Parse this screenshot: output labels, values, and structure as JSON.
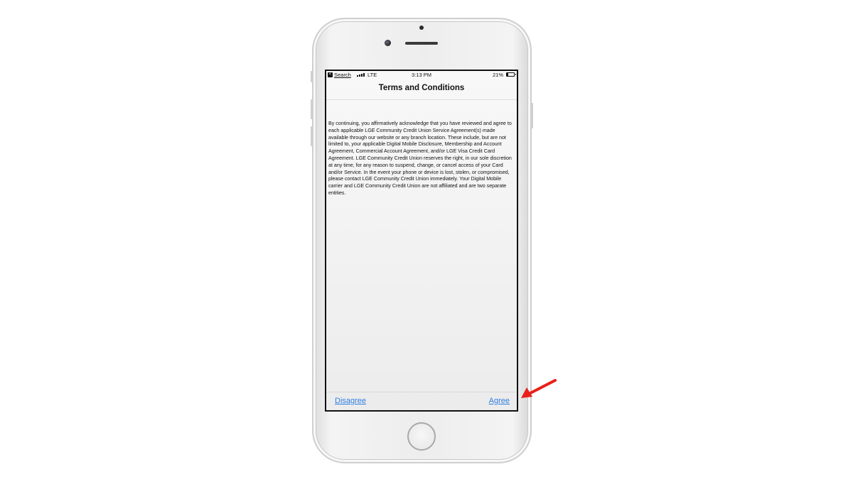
{
  "status_bar": {
    "back_badge": "<",
    "back_label": "Search",
    "carrier": "LTE",
    "time": "3:13 PM",
    "battery_percent": "21%",
    "battery_level": 0.21,
    "signal_bars": 4
  },
  "header": {
    "title": "Terms and Conditions"
  },
  "terms": {
    "body": "By continuing, you affirmatively acknowledge that you have reviewed and agree to each applicable LGE Community Credit Union Service Agreement(s) made available through our website or any branch location. These include, but are not limited to, your applicable Digital Mobile Disclosure, Membership and Account Agreement, Commercial Account Agreement, and/or LGE Visa Credit Card Agreement. LGE Community Credit Union reserves the right, in our sole discretion at any time, for any reason to suspend, change, or cancel access of your Card and/or Service. In the event your phone or device is lost, stolen, or compromised, please contact LGE Community Credit Union immediately. Your Digital Mobile carrier and LGE Community Credit Union are not affiliated and are two separate entities."
  },
  "actions": {
    "disagree_label": "Disagree",
    "agree_label": "Agree"
  },
  "colors": {
    "link": "#2f7de1",
    "annotation_arrow": "#e8201c"
  },
  "icons": {
    "annotation": "red-arrow-icon",
    "home": "home-button-icon"
  }
}
